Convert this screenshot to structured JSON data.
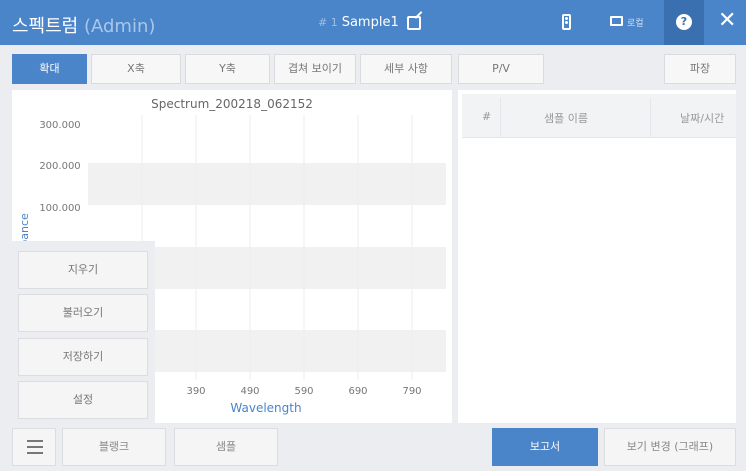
{
  "header": {
    "title": "스펙트럼",
    "title_suffix": "(Admin)",
    "sample_number": "# 1",
    "sample_name": "Sample1",
    "chat_label": "로컬",
    "help_label": "?",
    "close_label": "✕"
  },
  "tabs": [
    "확대",
    "X축",
    "Y축",
    "겹쳐 보이기",
    "세부 사항",
    "P/V",
    "파장"
  ],
  "chart": {
    "title": "Spectrum_200218_062152",
    "ylabel_partial": "bance",
    "xlabel": "Wavelength",
    "yticks": [
      "300.000",
      "200.000",
      "100.000"
    ],
    "xticks": [
      "390",
      "490",
      "590",
      "690",
      "790"
    ]
  },
  "chart_data": {
    "type": "line",
    "title": "Spectrum_200218_062152",
    "xlabel": "Wavelength",
    "ylabel": "bance",
    "x_ticks": [
      390,
      490,
      590,
      690,
      790
    ],
    "y_ticks": [
      100,
      200,
      300
    ],
    "series": [],
    "grid": true
  },
  "side_menu": [
    "지우기",
    "불러오기",
    "저장하기",
    "설정"
  ],
  "sample_list": {
    "columns": [
      "#",
      "샘플 이름",
      "날짜/시간"
    ],
    "rows": []
  },
  "bottom": {
    "blank": "블랭크",
    "sample": "샘플",
    "report": "보고서",
    "view_change": "보기 변경 (그래프)"
  },
  "colors": {
    "primary": "#4a84c9",
    "background": "#ecedf0"
  }
}
